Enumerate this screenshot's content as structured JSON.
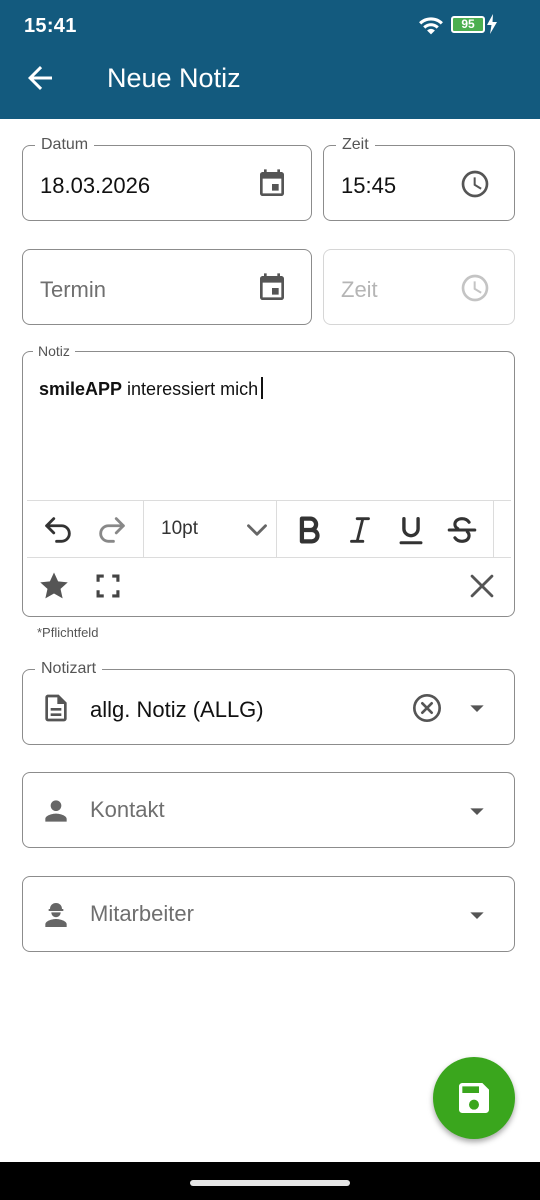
{
  "status": {
    "time": "15:41",
    "battery": "95"
  },
  "header": {
    "title": "Neue Notiz"
  },
  "form": {
    "datum": {
      "label": "Datum",
      "value": "18.03.2026"
    },
    "zeit1": {
      "label": "Zeit",
      "value": "15:45"
    },
    "termin": {
      "placeholder": "Termin"
    },
    "zeit2": {
      "placeholder": "Zeit"
    },
    "notiz": {
      "label": "Notiz",
      "bold_text": "smileAPP",
      "text": " interessiert mich",
      "font_size": "10pt"
    },
    "hint": "*Pflichtfeld",
    "notizart": {
      "label": "Notizart",
      "value": "allg. Notiz (ALLG)"
    },
    "kontakt": {
      "placeholder": "Kontakt"
    },
    "mitarbeiter": {
      "placeholder": "Mitarbeiter"
    }
  },
  "colors": {
    "appbar": "#135a7e",
    "fab": "#3aa61d"
  },
  "icons": [
    "back-arrow-icon",
    "calendar-icon",
    "clock-icon",
    "undo-icon",
    "redo-icon",
    "chevron-down-icon",
    "bold-icon",
    "italic-icon",
    "underline-icon",
    "strikethrough-icon",
    "star-icon",
    "fullscreen-icon",
    "close-icon",
    "document-icon",
    "clear-circle-icon",
    "dropdown-arrow-icon",
    "person-icon",
    "worker-icon",
    "save-icon"
  ]
}
